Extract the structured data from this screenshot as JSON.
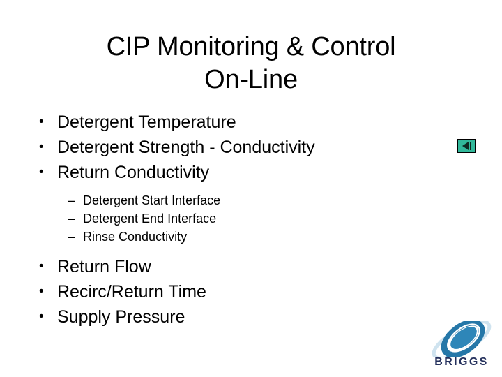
{
  "slide": {
    "background_color": "#ffffff",
    "title": "CIP Monitoring & Control\nOn-Line",
    "bullets": [
      {
        "level": 1,
        "marker": "•",
        "text": "Detergent Temperature"
      },
      {
        "level": 1,
        "marker": "•",
        "text": "Detergent Strength - Conductivity"
      },
      {
        "level": 1,
        "marker": "•",
        "text": "Return Conductivity"
      },
      {
        "level": 2,
        "marker": "–",
        "text": "Detergent Start Interface"
      },
      {
        "level": 2,
        "marker": "–",
        "text": "Detergent End Interface"
      },
      {
        "level": 2,
        "marker": "–",
        "text": "Rinse Conductivity"
      },
      {
        "level": 1,
        "marker": "•",
        "text": "Return Flow"
      },
      {
        "level": 1,
        "marker": "•",
        "text": "Recirc/Return Time"
      },
      {
        "level": 1,
        "marker": "•",
        "text": "Supply Pressure"
      }
    ]
  },
  "nav_icon": {
    "name": "previous-slide-icon",
    "background_color": "#31b89a",
    "glyph_color": "#0d2a22",
    "border_color": "#000000"
  },
  "logo": {
    "wordmark": "BRIGGS",
    "wordmark_color": "#24305c",
    "swoosh_color": "#2577a8",
    "swoosh_inner_color": "#2e86b8",
    "swoosh_highlight_color": "#cfe3ef"
  }
}
